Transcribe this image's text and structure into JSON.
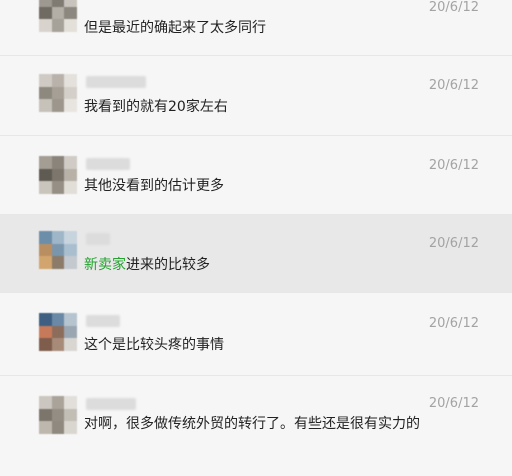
{
  "messages": [
    {
      "time": "20/6/12",
      "text": "但是最近的确起来了太多同行"
    },
    {
      "time": "20/6/12",
      "text": "我看到的就有20家左右"
    },
    {
      "time": "20/6/12",
      "text": "其他没看到的估计更多"
    },
    {
      "time": "20/6/12",
      "text_highlight": "新卖家",
      "text": "进来的比较多"
    },
    {
      "time": "20/6/12",
      "text": "这个是比较头疼的事情"
    },
    {
      "time": "20/6/12",
      "text": "对啊，很多做传统外贸的转行了。有些还是很有实力的"
    }
  ],
  "colors": {
    "highlight_text": "#25a230",
    "timestamp": "#a3a3a3",
    "row_selected": "#e8e8e8"
  }
}
